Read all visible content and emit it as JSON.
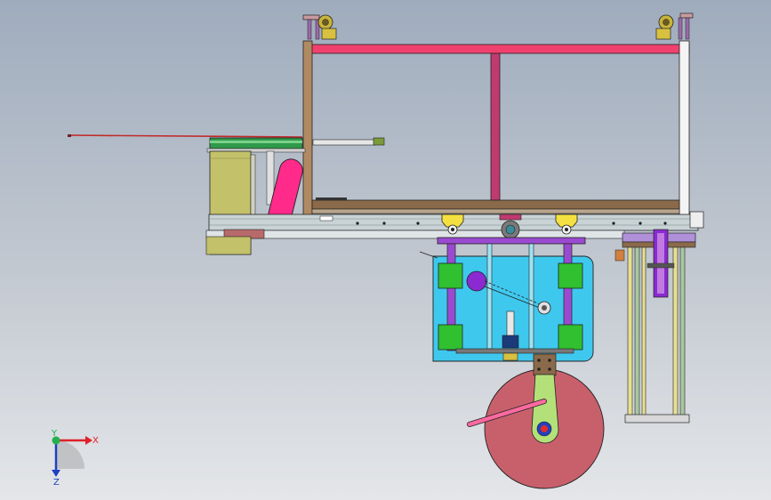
{
  "view": {
    "background_top": "#9facbd",
    "background_bottom": "#e4e6e9"
  },
  "triad": {
    "x_label": "X",
    "y_label": "Y",
    "z_label": "Z",
    "x_color": "#e0202a",
    "y_color": "#22b14c",
    "z_color": "#2040c0"
  },
  "colors": {
    "frame_top": "#f0416e",
    "frame_left": "#b08a62",
    "frame_bottom": "#8a6a4a",
    "frame_center": "#c03a70",
    "rail": "#c9d3d6",
    "hopper_green": "#2f9a4a",
    "olive": "#c3c16a",
    "magenta": "#ff2a8a",
    "yellow": "#f4e040",
    "carriage": "#3fc8ee",
    "slide_purple": "#9a4ad0",
    "slide_green": "#30c030",
    "disk": "#c8606c",
    "arm": "#b4e07a",
    "column": "#e8e090"
  }
}
